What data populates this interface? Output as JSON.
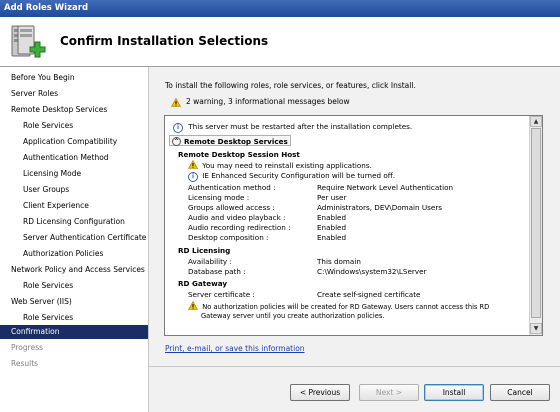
{
  "window": {
    "title": "Add Roles Wizard"
  },
  "header": {
    "title": "Confirm Installation Selections",
    "icon": "server-roles-add-icon"
  },
  "nav": [
    {
      "label": "Before You Begin",
      "level": 0,
      "state": "normal"
    },
    {
      "label": "Server Roles",
      "level": 0,
      "state": "normal"
    },
    {
      "label": "Remote Desktop Services",
      "level": 0,
      "state": "normal"
    },
    {
      "label": "Role Services",
      "level": 1,
      "state": "normal"
    },
    {
      "label": "Application Compatibility",
      "level": 1,
      "state": "normal"
    },
    {
      "label": "Authentication Method",
      "level": 1,
      "state": "normal"
    },
    {
      "label": "Licensing Mode",
      "level": 1,
      "state": "normal"
    },
    {
      "label": "User Groups",
      "level": 1,
      "state": "normal"
    },
    {
      "label": "Client Experience",
      "level": 1,
      "state": "normal"
    },
    {
      "label": "RD Licensing Configuration",
      "level": 1,
      "state": "normal"
    },
    {
      "label": "Server Authentication Certificate",
      "level": 1,
      "state": "normal"
    },
    {
      "label": "Authorization Policies",
      "level": 1,
      "state": "normal"
    },
    {
      "label": "Network Policy and Access Services",
      "level": 0,
      "state": "normal"
    },
    {
      "label": "Role Services",
      "level": 1,
      "state": "normal"
    },
    {
      "label": "Web Server (IIS)",
      "level": 0,
      "state": "normal"
    },
    {
      "label": "Role Services",
      "level": 1,
      "state": "normal"
    },
    {
      "label": "Confirmation",
      "level": 0,
      "state": "active"
    },
    {
      "label": "Progress",
      "level": 0,
      "state": "disabled"
    },
    {
      "label": "Results",
      "level": 0,
      "state": "disabled"
    }
  ],
  "main": {
    "intro": "To install the following roles, role services, or features, click Install.",
    "warning_summary": "2 warning, 3 informational messages below",
    "restart_message": "This server must be restarted after the installation completes.",
    "section_title": "Remote Desktop Services",
    "rdsh": {
      "title": "Remote Desktop Session Host",
      "warning": "You may need to reinstall existing applications.",
      "info": "IE Enhanced Security Configuration will be turned off.",
      "props": [
        {
          "key": "Authentication method :",
          "value": "Require Network Level Authentication"
        },
        {
          "key": "Licensing mode :",
          "value": "Per user"
        },
        {
          "key": "Groups allowed access :",
          "value": "Administrators, DEV\\Domain Users"
        },
        {
          "key": "Audio and video playback :",
          "value": "Enabled"
        },
        {
          "key": "Audio recording redirection :",
          "value": "Enabled"
        },
        {
          "key": "Desktop composition :",
          "value": "Enabled"
        }
      ]
    },
    "rdlic": {
      "title": "RD Licensing",
      "props": [
        {
          "key": "Availability :",
          "value": "This domain"
        },
        {
          "key": "Database path :",
          "value": "C:\\Windows\\system32\\LServer"
        }
      ]
    },
    "rdgw": {
      "title": "RD Gateway",
      "props": [
        {
          "key": "Server certificate :",
          "value": "Create self-signed certificate"
        }
      ],
      "warning_line1": "No authorization policies will be created for RD Gateway. Users cannot access this RD",
      "warning_line2": "Gateway server until you create authorization policies."
    },
    "link": "Print, e-mail, or save this information"
  },
  "buttons": {
    "previous": "< Previous",
    "next": "Next >",
    "install": "Install",
    "cancel": "Cancel"
  },
  "colors": {
    "nav_active": "#1c2c66",
    "title_bar": "#2a55a8",
    "link": "#1a3fb0",
    "warning": "#f2c200",
    "info": "#3a5fb0"
  }
}
